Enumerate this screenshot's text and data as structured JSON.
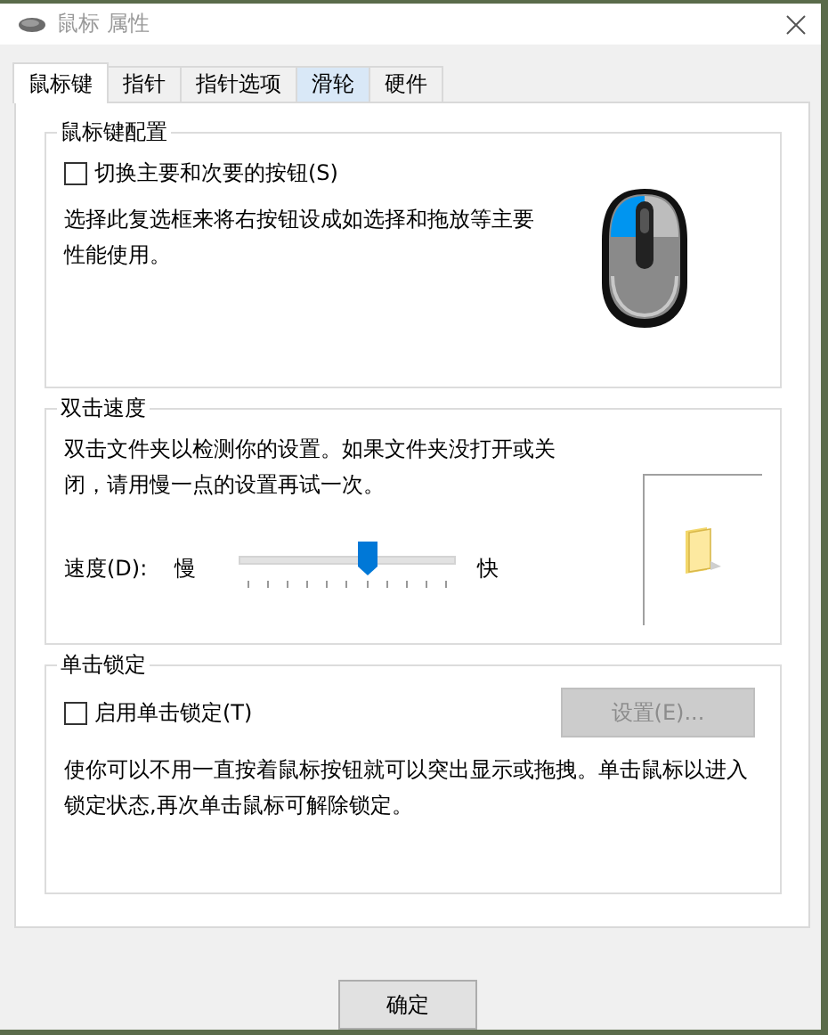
{
  "window": {
    "title": "鼠标 属性"
  },
  "tabs": [
    {
      "label": "鼠标键",
      "selected": true,
      "hovered": false
    },
    {
      "label": "指针",
      "selected": false,
      "hovered": false
    },
    {
      "label": "指针选项",
      "selected": false,
      "hovered": false
    },
    {
      "label": "滑轮",
      "selected": false,
      "hovered": true
    },
    {
      "label": "硬件",
      "selected": false,
      "hovered": false
    }
  ],
  "button_config": {
    "title": "鼠标键配置",
    "checkbox": {
      "label": "切换主要和次要的按钮(S)",
      "checked": false
    },
    "description": "选择此复选框来将右按钮设成如选择和拖放等主要性能使用。"
  },
  "double_click": {
    "title": "双击速度",
    "description": "双击文件夹以检测你的设置。如果文件夹没打开或关闭，请用慢一点的设置再试一次。",
    "speed_label": "速度(D):",
    "slow": "慢",
    "fast": "快",
    "level": 0.6
  },
  "click_lock": {
    "title": "单击锁定",
    "checkbox": {
      "label": "启用单击锁定(T)",
      "checked": false
    },
    "settings_button": {
      "label": "设置(E)...",
      "disabled": true
    },
    "description": "使你可以不用一直按着鼠标按钮就可以突出显示或拖拽。单击鼠标以进入锁定状态,再次单击鼠标可解除锁定。"
  },
  "buttons": [
    {
      "label": "确定"
    }
  ]
}
